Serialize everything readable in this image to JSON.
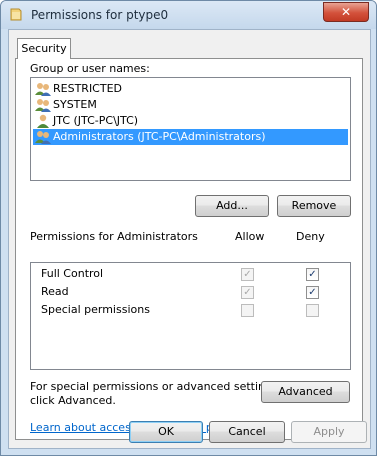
{
  "window": {
    "title": "Permissions for ptype0",
    "close_glyph": "✕"
  },
  "tabs": [
    {
      "label": "Security"
    }
  ],
  "group_section": {
    "label": "Group or user names:",
    "users": [
      {
        "name": "RESTRICTED",
        "icon": "group-icon"
      },
      {
        "name": "SYSTEM",
        "icon": "group-icon"
      },
      {
        "name": "JTC (JTC-PC\\JTC)",
        "icon": "user-icon"
      },
      {
        "name": "Administrators (JTC-PC\\Administrators)",
        "icon": "group-icon",
        "selected": true
      }
    ],
    "add_button": "Add...",
    "remove_button": "Remove"
  },
  "permissions": {
    "label": "Permissions for Administrators",
    "col_allow": "Allow",
    "col_deny": "Deny",
    "rows": [
      {
        "name": "Full Control",
        "allow": true,
        "allow_enabled": false,
        "deny": true,
        "deny_enabled": true
      },
      {
        "name": "Read",
        "allow": true,
        "allow_enabled": false,
        "deny": true,
        "deny_enabled": true
      },
      {
        "name": "Special permissions",
        "allow": false,
        "allow_enabled": false,
        "deny": false,
        "deny_enabled": false
      }
    ]
  },
  "advanced": {
    "text_line1": "For special permissions or advanced settings,",
    "text_line2": "click Advanced.",
    "button": "Advanced"
  },
  "help_link": "Learn about access control and permissions",
  "footer": {
    "ok": "OK",
    "cancel": "Cancel",
    "apply": "Apply"
  },
  "colors": {
    "selection": "#3399ff",
    "link": "#0066cc",
    "close_button": "#c23a24"
  }
}
